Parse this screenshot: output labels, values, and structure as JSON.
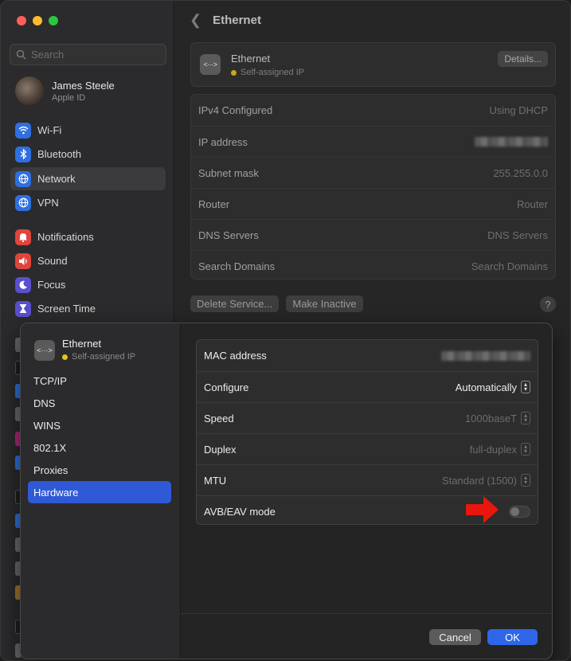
{
  "sidebar": {
    "search_placeholder": "Search",
    "account": {
      "name": "James Steele",
      "subtitle": "Apple ID"
    },
    "items": [
      {
        "label": "Wi-Fi",
        "icon": "wifi-icon",
        "color": "#2f6fe0"
      },
      {
        "label": "Bluetooth",
        "icon": "bluetooth-icon",
        "color": "#2f6fe0"
      },
      {
        "label": "Network",
        "icon": "globe-icon",
        "color": "#2f6fe0",
        "selected": true
      },
      {
        "label": "VPN",
        "icon": "vpn-globe-icon",
        "color": "#2f6fe0"
      },
      {
        "label": "Notifications",
        "icon": "bell-icon",
        "color": "#e0443c"
      },
      {
        "label": "Sound",
        "icon": "speaker-icon",
        "color": "#e0443c"
      },
      {
        "label": "Focus",
        "icon": "moon-icon",
        "color": "#5a4fcf"
      },
      {
        "label": "Screen Time",
        "icon": "hourglass-icon",
        "color": "#5a4fcf"
      }
    ]
  },
  "content": {
    "title": "Ethernet",
    "service": {
      "name": "Ethernet",
      "status": "Self-assigned IP",
      "details_label": "Details..."
    },
    "info_rows": [
      {
        "label": "IPv4 Configured",
        "value": "Using DHCP"
      },
      {
        "label": "IP address",
        "value": ""
      },
      {
        "label": "Subnet mask",
        "value": "255.255.0.0"
      },
      {
        "label": "Router",
        "value": "Router"
      },
      {
        "label": "DNS Servers",
        "value": "DNS Servers"
      },
      {
        "label": "Search Domains",
        "value": "Search Domains"
      }
    ],
    "delete_label": "Delete Service...",
    "inactive_label": "Make Inactive",
    "help_label": "?"
  },
  "sheet": {
    "service": {
      "name": "Ethernet",
      "status": "Self-assigned IP"
    },
    "tabs": [
      "TCP/IP",
      "DNS",
      "WINS",
      "802.1X",
      "Proxies",
      "Hardware"
    ],
    "selected_tab": "Hardware",
    "hardware": {
      "mac_label": "MAC address",
      "configure_label": "Configure",
      "configure_value": "Automatically",
      "speed_label": "Speed",
      "speed_value": "1000baseT",
      "duplex_label": "Duplex",
      "duplex_value": "full-duplex",
      "mtu_label": "MTU",
      "mtu_value": "Standard (1500)",
      "avb_label": "AVB/EAV mode",
      "avb_enabled": false
    },
    "cancel_label": "Cancel",
    "ok_label": "OK"
  },
  "colors": {
    "accent": "#2f66e8",
    "selected_tab": "#2f59d6",
    "status_dot": "#c9a90f",
    "arrow": "#e8160c"
  }
}
